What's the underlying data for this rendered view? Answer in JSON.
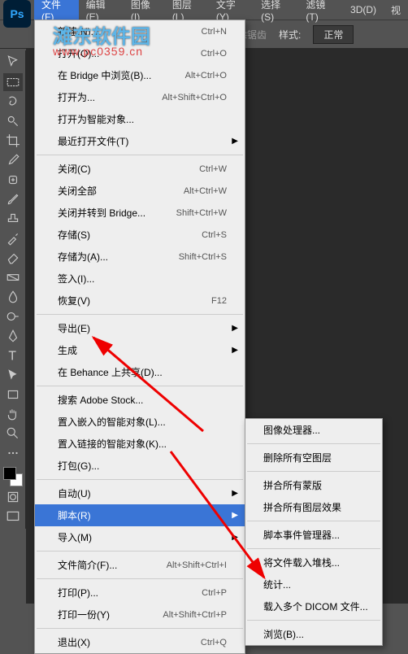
{
  "menubar": {
    "items": [
      "文件(F)",
      "编辑(E)",
      "图像(I)",
      "图层(L)",
      "文字(Y)",
      "选择(S)",
      "滤镜(T)",
      "3D(D)",
      "视"
    ],
    "active_index": 0
  },
  "logo": {
    "text": "Ps"
  },
  "watermark": {
    "text": "滩东软件园",
    "url": "www.pc0359.cn"
  },
  "options_bar": {
    "anti_alias": "消除锯齿",
    "style_label": "样式:",
    "style_value": "正常"
  },
  "file_menu": {
    "items": [
      {
        "label": "新建(N)...",
        "shortcut": "Ctrl+N"
      },
      {
        "label": "打开(O)...",
        "shortcut": "Ctrl+O"
      },
      {
        "label": "在 Bridge 中浏览(B)...",
        "shortcut": "Alt+Ctrl+O"
      },
      {
        "label": "打开为...",
        "shortcut": "Alt+Shift+Ctrl+O"
      },
      {
        "label": "打开为智能对象..."
      },
      {
        "label": "最近打开文件(T)",
        "submenu": true
      },
      {
        "sep": true
      },
      {
        "label": "关闭(C)",
        "shortcut": "Ctrl+W"
      },
      {
        "label": "关闭全部",
        "shortcut": "Alt+Ctrl+W"
      },
      {
        "label": "关闭并转到 Bridge...",
        "shortcut": "Shift+Ctrl+W"
      },
      {
        "label": "存储(S)",
        "shortcut": "Ctrl+S"
      },
      {
        "label": "存储为(A)...",
        "shortcut": "Shift+Ctrl+S"
      },
      {
        "label": "签入(I)..."
      },
      {
        "label": "恢复(V)",
        "shortcut": "F12"
      },
      {
        "sep": true
      },
      {
        "label": "导出(E)",
        "submenu": true
      },
      {
        "label": "生成",
        "submenu": true
      },
      {
        "label": "在 Behance 上共享(D)..."
      },
      {
        "sep": true
      },
      {
        "label": "搜索 Adobe Stock..."
      },
      {
        "label": "置入嵌入的智能对象(L)..."
      },
      {
        "label": "置入链接的智能对象(K)..."
      },
      {
        "label": "打包(G)..."
      },
      {
        "sep": true
      },
      {
        "label": "自动(U)",
        "submenu": true
      },
      {
        "label": "脚本(R)",
        "submenu": true,
        "highlighted": true
      },
      {
        "label": "导入(M)",
        "submenu": true
      },
      {
        "sep": true
      },
      {
        "label": "文件简介(F)...",
        "shortcut": "Alt+Shift+Ctrl+I"
      },
      {
        "sep": true
      },
      {
        "label": "打印(P)...",
        "shortcut": "Ctrl+P"
      },
      {
        "label": "打印一份(Y)",
        "shortcut": "Alt+Shift+Ctrl+P"
      },
      {
        "sep": true
      },
      {
        "label": "退出(X)",
        "shortcut": "Ctrl+Q"
      }
    ]
  },
  "script_submenu": {
    "items": [
      {
        "label": "图像处理器..."
      },
      {
        "sep": true
      },
      {
        "label": "删除所有空图层"
      },
      {
        "sep": true
      },
      {
        "label": "拼合所有蒙版"
      },
      {
        "label": "拼合所有图层效果"
      },
      {
        "sep": true
      },
      {
        "label": "脚本事件管理器..."
      },
      {
        "sep": true
      },
      {
        "label": "将文件载入堆栈..."
      },
      {
        "label": "统计..."
      },
      {
        "label": "载入多个 DICOM 文件..."
      },
      {
        "sep": true
      },
      {
        "label": "浏览(B)..."
      }
    ]
  },
  "tools": [
    "move",
    "marquee",
    "lasso",
    "quick-select",
    "crop",
    "eyedropper",
    "heal",
    "brush",
    "stamp",
    "history-brush",
    "eraser",
    "gradient",
    "blur",
    "dodge",
    "pen",
    "type",
    "path-select",
    "rectangle",
    "hand",
    "zoom",
    "more",
    "colors",
    "quickmask",
    "screen"
  ]
}
